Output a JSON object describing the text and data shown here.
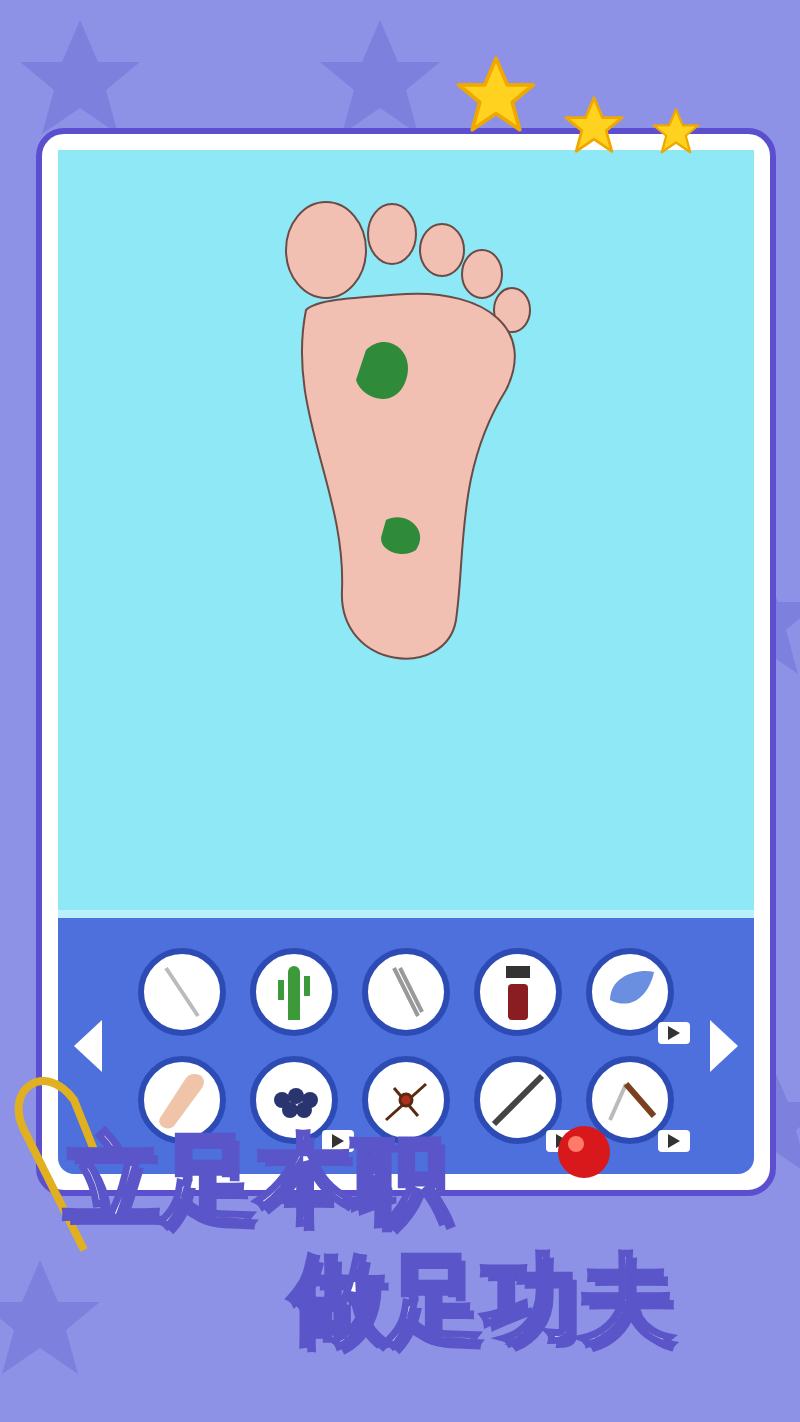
{
  "tools": [
    {
      "kind": "swab",
      "video": false
    },
    {
      "kind": "cactus",
      "video": false
    },
    {
      "kind": "tweezers",
      "video": false
    },
    {
      "kind": "spray",
      "video": false
    },
    {
      "kind": "leaf",
      "video": true
    },
    {
      "kind": "finger",
      "video": false
    },
    {
      "kind": "grapes",
      "video": true
    },
    {
      "kind": "mosquito",
      "video": false
    },
    {
      "kind": "pencil",
      "video": true
    },
    {
      "kind": "razor",
      "video": true
    }
  ],
  "slogan": [
    "立足本职",
    "做足功夫"
  ]
}
